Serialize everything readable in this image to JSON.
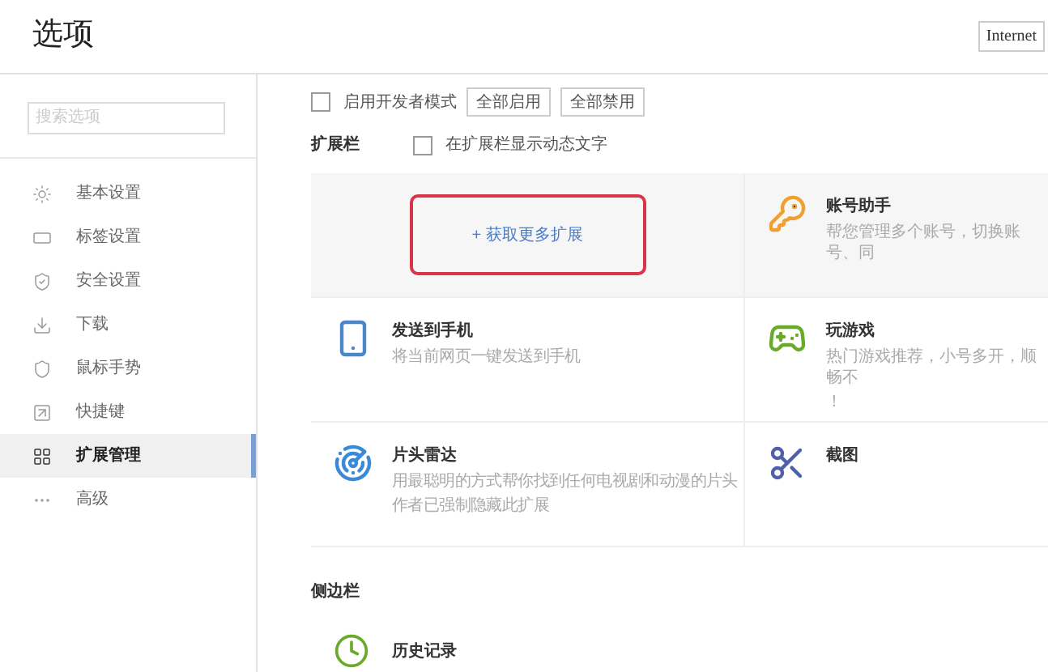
{
  "header": {
    "title": "选项",
    "browser_field": "Internet"
  },
  "sidebar": {
    "search": {
      "placeholder": "搜索选项"
    },
    "items": [
      {
        "label": "基本设置",
        "selected": false
      },
      {
        "label": "标签设置",
        "selected": false
      },
      {
        "label": "安全设置",
        "selected": false
      },
      {
        "label": "下载",
        "selected": false
      },
      {
        "label": "鼠标手势",
        "selected": false
      },
      {
        "label": "快捷键",
        "selected": false
      },
      {
        "label": "扩展管理",
        "selected": true
      },
      {
        "label": "高级",
        "selected": false
      }
    ]
  },
  "toolbar": {
    "dev_mode": {
      "label": "启用开发者模式",
      "checked": false
    },
    "buttons": [
      "全部启用",
      "全部禁用"
    ]
  },
  "extension_bar": {
    "title": "扩展栏",
    "show_text": {
      "label": "在扩展栏显示动态文字",
      "checked": false
    },
    "cards": [
      {
        "kind": "add",
        "label": "+ 获取更多扩展",
        "highlighted": true
      },
      {
        "kind": "extension",
        "name": "账号助手",
        "description": [
          "帮您管理多个账号，切换账号、同"
        ]
      },
      {
        "kind": "extension",
        "name": "发送到手机",
        "description": [
          "将当前网页一键发送到手机"
        ]
      },
      {
        "kind": "extension",
        "name": "玩游戏",
        "description": [
          "热门游戏推荐，小号多开，顺畅不",
          "！"
        ]
      },
      {
        "kind": "extension",
        "name": "片头雷达",
        "description": [
          "用最聪明的方式帮你找到任何电视剧和动漫的片头",
          "作者已强制隐藏此扩展"
        ]
      },
      {
        "kind": "extension",
        "name": "截图"
      }
    ]
  },
  "side_bar": {
    "title": "侧边栏",
    "items": [
      {
        "name": "历史记录"
      }
    ]
  }
}
